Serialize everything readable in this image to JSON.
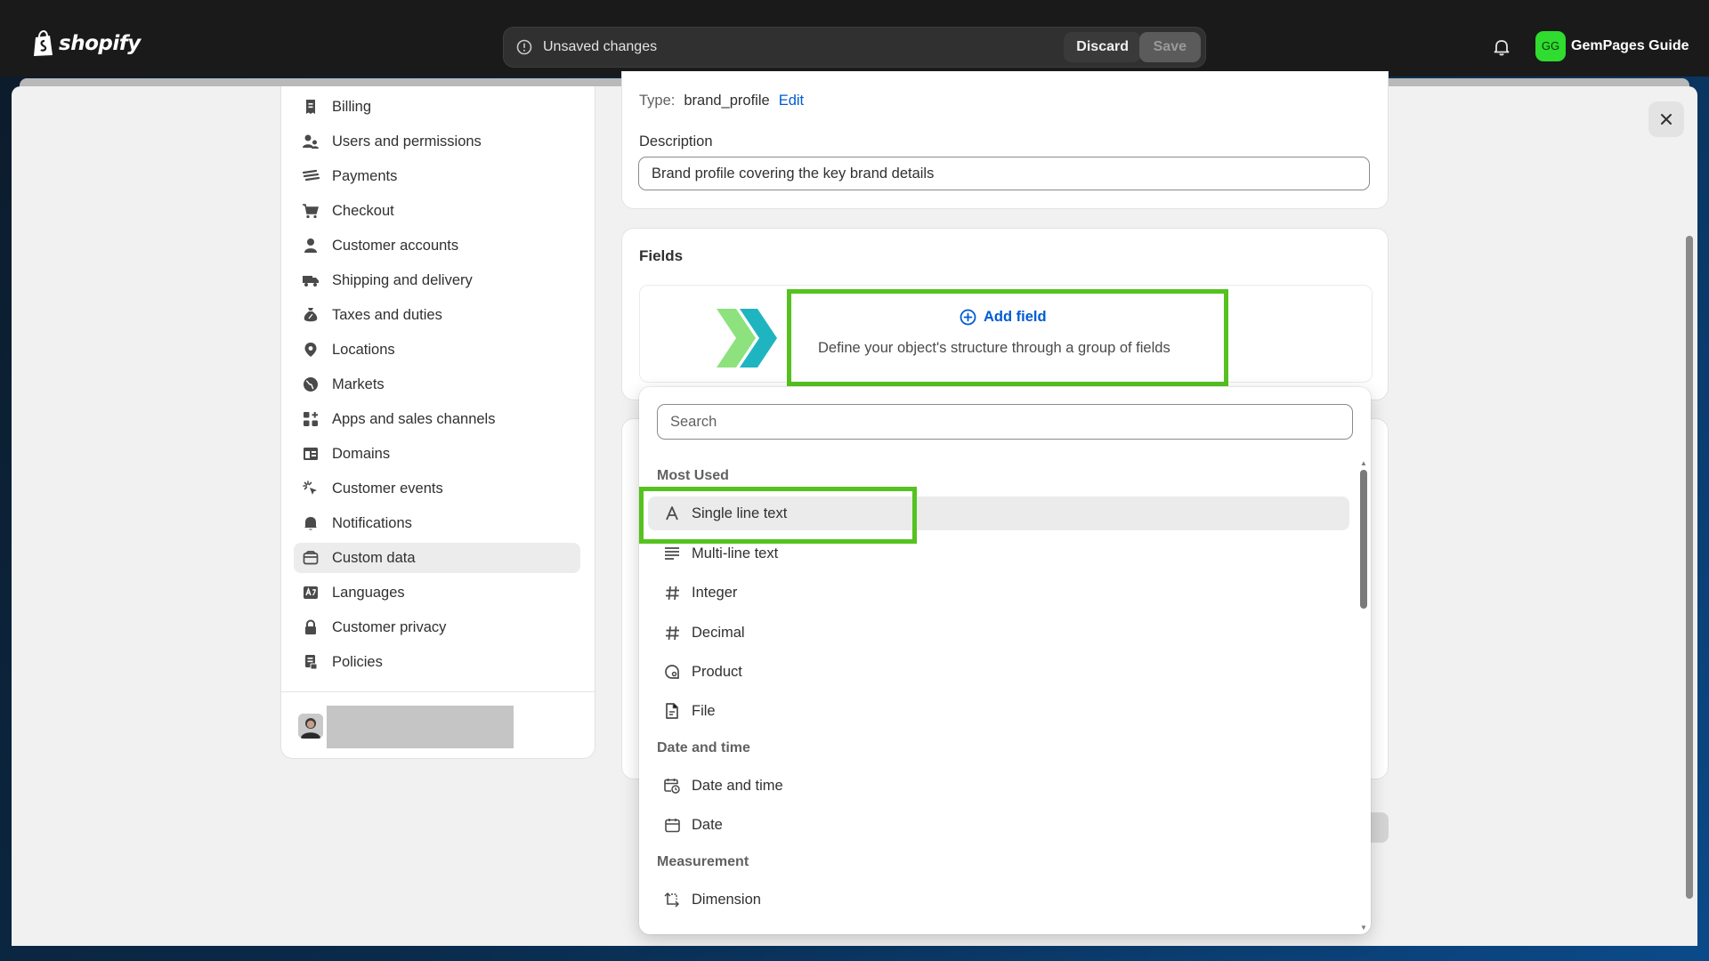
{
  "topbar": {
    "brand": "shopify",
    "unsaved_text": "Unsaved changes",
    "discard_label": "Discard",
    "save_label": "Save",
    "account_initials": "GG",
    "account_name": "GemPages Guide",
    "account_color": "#2fdc2f"
  },
  "sidebar": {
    "items": [
      {
        "label": "Billing",
        "icon": "receipt-icon"
      },
      {
        "label": "Users and permissions",
        "icon": "users-icon"
      },
      {
        "label": "Payments",
        "icon": "payments-icon"
      },
      {
        "label": "Checkout",
        "icon": "cart-icon"
      },
      {
        "label": "Customer accounts",
        "icon": "person-icon"
      },
      {
        "label": "Shipping and delivery",
        "icon": "truck-icon"
      },
      {
        "label": "Taxes and duties",
        "icon": "tax-icon"
      },
      {
        "label": "Locations",
        "icon": "location-pin-icon"
      },
      {
        "label": "Markets",
        "icon": "globe-icon"
      },
      {
        "label": "Apps and sales channels",
        "icon": "apps-icon"
      },
      {
        "label": "Domains",
        "icon": "domain-icon"
      },
      {
        "label": "Customer events",
        "icon": "cursor-click-icon"
      },
      {
        "label": "Notifications",
        "icon": "bell-icon"
      },
      {
        "label": "Custom data",
        "icon": "custom-data-icon",
        "active": true
      },
      {
        "label": "Languages",
        "icon": "language-icon"
      },
      {
        "label": "Customer privacy",
        "icon": "lock-icon"
      },
      {
        "label": "Policies",
        "icon": "policy-icon"
      }
    ]
  },
  "definition": {
    "type_label": "Type:",
    "type_value": "brand_profile",
    "edit_label": "Edit",
    "description_label": "Description",
    "description_value": "Brand profile covering the key brand details"
  },
  "fields": {
    "title": "Fields",
    "add_field_label": "Add field",
    "help_text": "Define your object's structure through a group of fields"
  },
  "dropdown": {
    "search_placeholder": "Search",
    "groups": [
      {
        "title": "Most Used",
        "options": [
          {
            "label": "Single line text",
            "icon": "text-a-icon",
            "hover": true
          },
          {
            "label": "Multi-line text",
            "icon": "multiline-icon"
          },
          {
            "label": "Integer",
            "icon": "hash-icon"
          },
          {
            "label": "Decimal",
            "icon": "hash-icon"
          },
          {
            "label": "Product",
            "icon": "product-tag-icon"
          },
          {
            "label": "File",
            "icon": "file-icon"
          }
        ]
      },
      {
        "title": "Date and time",
        "options": [
          {
            "label": "Date and time",
            "icon": "calendar-clock-icon"
          },
          {
            "label": "Date",
            "icon": "calendar-icon"
          }
        ]
      },
      {
        "title": "Measurement",
        "options": [
          {
            "label": "Dimension",
            "icon": "dimension-icon"
          }
        ]
      }
    ]
  },
  "colors": {
    "highlight": "#55c21f",
    "link": "#005bd3"
  }
}
